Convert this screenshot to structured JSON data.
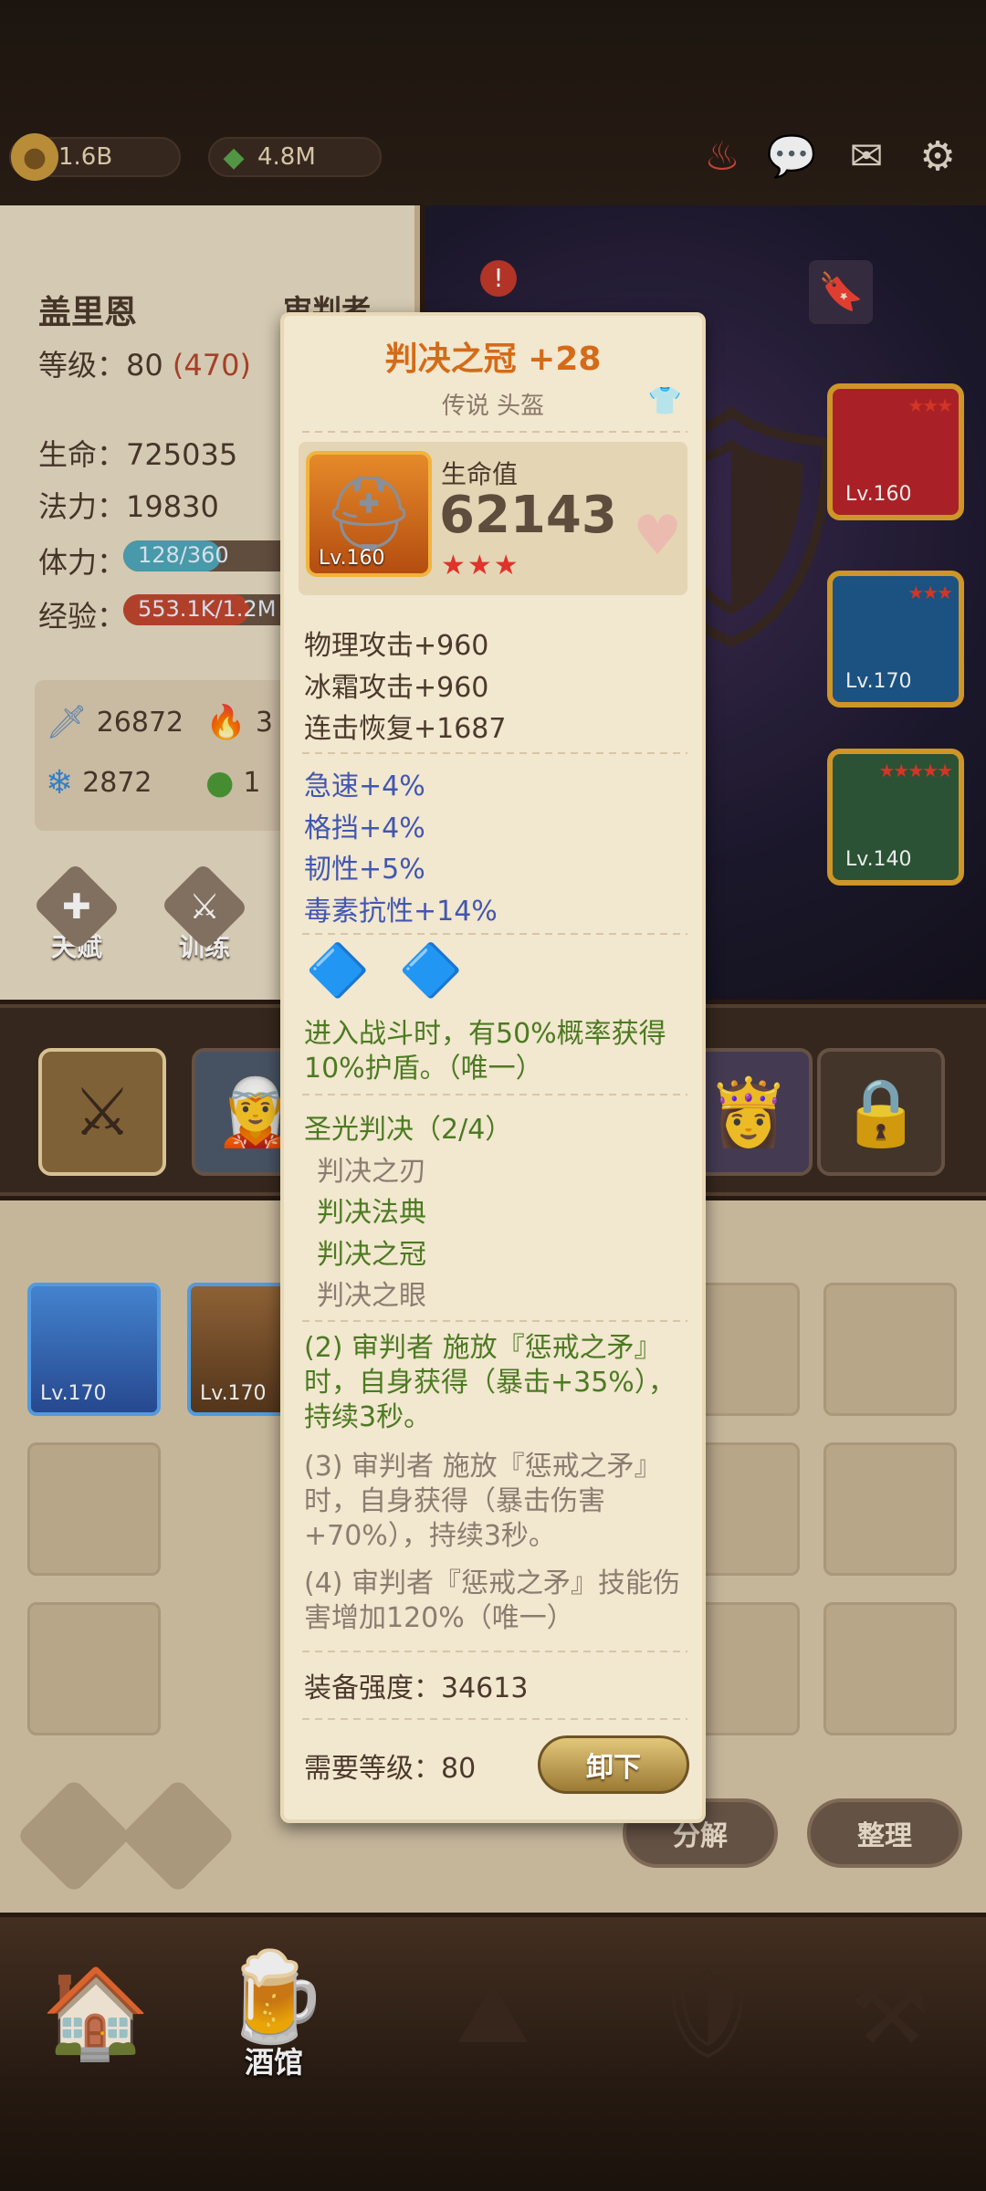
{
  "resources": {
    "gold": "1.6B",
    "gems": "4.8M"
  },
  "character": {
    "name": "盖里恩",
    "class": "审判者",
    "level_label": "等级：",
    "level": "80",
    "level_extra": "(470)",
    "hp_label": "生命：",
    "hp": "725035",
    "mp_label": "法力：",
    "mp": "19830",
    "stamina_label": "体力：",
    "stamina": "128/360",
    "stamina_fraction": 0.356,
    "exp_label": "经验：",
    "exp": "553.1K/1.2M",
    "exp_fraction": 0.46,
    "attr_attack": "26872",
    "attr_fire": "3",
    "attr_ice": "2872",
    "attr_poison": "1",
    "talent_label": "天赋",
    "train_label": "训练"
  },
  "equip_slots": [
    {
      "level": "Lv.160",
      "stars": "★★★"
    },
    {
      "level": "Lv.170",
      "stars": "★★★"
    },
    {
      "level": "Lv.140",
      "stars": "★★★★★"
    }
  ],
  "inventory": [
    {
      "level": "Lv.170",
      "icon": "helmet-icon"
    },
    {
      "level": "Lv.170",
      "icon": "boots-icon"
    }
  ],
  "buttons": {
    "decompose": "分解",
    "organize": "整理"
  },
  "nav": {
    "tavern": "酒馆"
  },
  "tooltip": {
    "title": "判决之冠 +28",
    "subtitle": "传说 头盔",
    "item_level": "Lv.160",
    "hp_label": "生命值",
    "hp_value": "62143",
    "stars": "★★★",
    "base_stats": [
      "物理攻击+960",
      "冰霜攻击+960",
      "连击恢复+1687"
    ],
    "extra_stats": [
      "急速+4%",
      "格挡+4%",
      "韧性+5%",
      "毒素抗性+14%"
    ],
    "gem_effect": "进入战斗时，有50%概率获得10%护盾。（唯一）",
    "set_name": "圣光判决（2/4）",
    "set_items": [
      {
        "name": "判决之刃",
        "owned": false
      },
      {
        "name": "判决法典",
        "owned": true
      },
      {
        "name": "判决之冠",
        "owned": true
      },
      {
        "name": "判决之眼",
        "owned": false
      }
    ],
    "set_bonus_2": "(2) 审判者 施放『惩戒之矛』时，自身获得（暴击+35%），持续3秒。",
    "set_bonus_3": "(3) 审判者 施放『惩戒之矛』时，自身获得（暴击伤害+70%），持续3秒。",
    "set_bonus_4": "(4) 审判者『惩戒之矛』技能伤害增加120%（唯一）",
    "power_label": "装备强度：",
    "power": "34613",
    "req_label": "需要等级：",
    "req_level": "80",
    "unequip": "卸下"
  }
}
